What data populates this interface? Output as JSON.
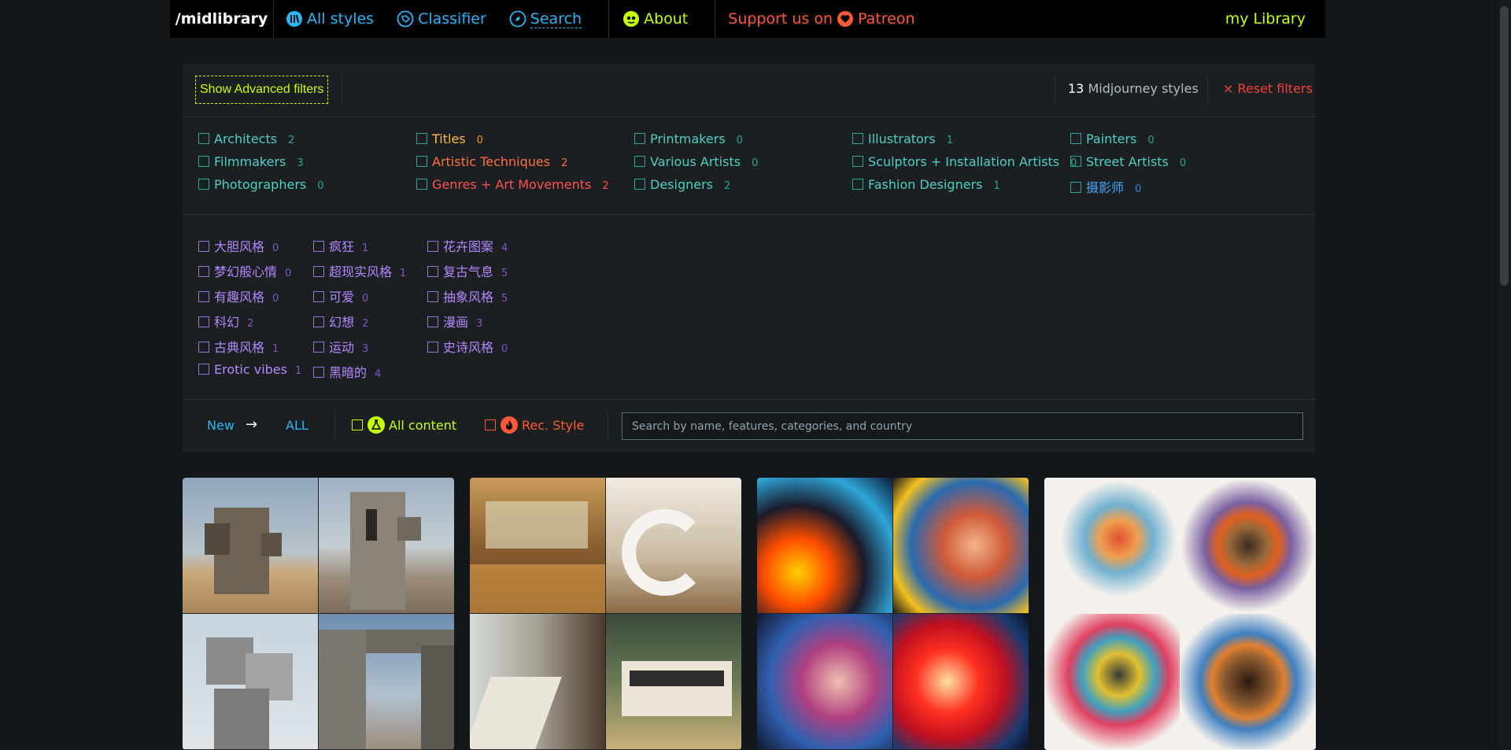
{
  "nav": {
    "logo": "/midlibrary",
    "all_styles": "All styles",
    "classifier": "Classifier",
    "search": "Search",
    "about": "About",
    "support_prefix": "Support us on",
    "patreon": "Patreon",
    "my_library": "my Library"
  },
  "filters": {
    "show_advanced": "Show Advanced filters",
    "styles_count": "13",
    "styles_suffix": "Midjourney styles",
    "reset": "× Reset filters",
    "categories": [
      {
        "label": "Architects",
        "count": "2"
      },
      {
        "label": "Filmmakers",
        "count": "3"
      },
      {
        "label": "Photographers",
        "count": "0"
      },
      {
        "label": "Titles",
        "count": "0"
      },
      {
        "label": "Artistic Techniques",
        "count": "2"
      },
      {
        "label": "Genres + Art Movements",
        "count": "2"
      },
      {
        "label": "Printmakers",
        "count": "0"
      },
      {
        "label": "Various Artists",
        "count": "0"
      },
      {
        "label": "Designers",
        "count": "2"
      },
      {
        "label": "Illustrators",
        "count": "1"
      },
      {
        "label": "Sculptors + Installation Artists",
        "count": "0"
      },
      {
        "label": "Fashion Designers",
        "count": "1"
      },
      {
        "label": "Painters",
        "count": "0"
      },
      {
        "label": "Street Artists",
        "count": "0"
      },
      {
        "label": "摄影师",
        "count": "0"
      }
    ],
    "tags": [
      {
        "label": "大胆风格",
        "count": "0"
      },
      {
        "label": "梦幻般心情",
        "count": "0"
      },
      {
        "label": "有趣风格",
        "count": "0"
      },
      {
        "label": "科幻",
        "count": "2"
      },
      {
        "label": "古典风格",
        "count": "1"
      },
      {
        "label": "Erotic vibes",
        "count": "1"
      },
      {
        "label": "疯狂",
        "count": "1"
      },
      {
        "label": "超现实风格",
        "count": "1"
      },
      {
        "label": "可爱",
        "count": "0"
      },
      {
        "label": "幻想",
        "count": "2"
      },
      {
        "label": "运动",
        "count": "3"
      },
      {
        "label": "黑暗的",
        "count": "4"
      },
      {
        "label": "花卉图案",
        "count": "4"
      },
      {
        "label": "复古气息",
        "count": "5"
      },
      {
        "label": "抽象风格",
        "count": "5"
      },
      {
        "label": "漫画",
        "count": "3"
      },
      {
        "label": "史诗风格",
        "count": "0"
      }
    ],
    "sort_new": "New",
    "sort_arrow": "→",
    "sort_all": "ALL",
    "all_content": "All content",
    "rec_style": "Rec. Style",
    "search_placeholder": "Search by name, features, categories, and country"
  },
  "colors": {
    "accent_yellow": "#c6ff00",
    "accent_blue": "#29b6f6",
    "patreon_orange": "#ff5a36",
    "tag_purple": "#b388ff",
    "category_teal": "#4dd0c4"
  }
}
